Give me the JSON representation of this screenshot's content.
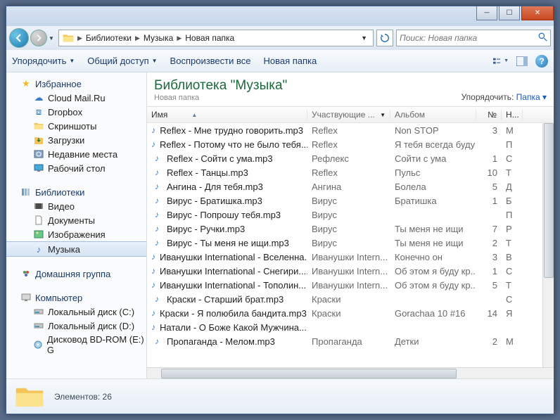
{
  "titlebar": {
    "min": "─",
    "max": "☐",
    "close": "✕"
  },
  "nav": {
    "crumbs": [
      "Библиотеки",
      "Музыка",
      "Новая папка"
    ],
    "search_placeholder": "Поиск: Новая папка"
  },
  "toolbar": {
    "organize": "Упорядочить",
    "share": "Общий доступ",
    "play_all": "Воспроизвести все",
    "new_folder": "Новая папка"
  },
  "sidebar": {
    "favorites": {
      "label": "Избранное",
      "items": [
        "Cloud Mail.Ru",
        "Dropbox",
        "Скриншоты",
        "Загрузки",
        "Недавние места",
        "Рабочий стол"
      ]
    },
    "libraries": {
      "label": "Библиотеки",
      "items": [
        "Видео",
        "Документы",
        "Изображения",
        "Музыка"
      ]
    },
    "homegroup": {
      "label": "Домашняя группа"
    },
    "computer": {
      "label": "Компьютер",
      "items": [
        "Локальный диск (C:)",
        "Локальный диск (D:)",
        "Дисковод BD-ROM (E:) G"
      ]
    }
  },
  "library": {
    "title": "Библиотека \"Музыка\"",
    "subtitle": "Новая папка",
    "arrange_label": "Упорядочить:",
    "arrange_value": "Папка"
  },
  "columns": {
    "name": "Имя",
    "artist": "Участвующие ...",
    "album": "Альбом",
    "num": "№",
    "h": "Н..."
  },
  "files": [
    {
      "name": "Reflex - Мне трудно говорить.mp3",
      "artist": "Reflex",
      "album": "Non STOP",
      "num": "3",
      "h": "М"
    },
    {
      "name": "Reflex - Потому что не было тебя....",
      "artist": "Reflex",
      "album": "Я тебя всегда буду ...",
      "num": "",
      "h": "П"
    },
    {
      "name": "Reflex - Сойти с ума.mp3",
      "artist": "Рефлекс",
      "album": "Сойти с ума",
      "num": "1",
      "h": "С"
    },
    {
      "name": "Reflex - Танцы.mp3",
      "artist": "Reflex",
      "album": "Пульс",
      "num": "10",
      "h": "Т"
    },
    {
      "name": "Ангина - Для тебя.mp3",
      "artist": "Ангина",
      "album": "Болела",
      "num": "5",
      "h": "Д"
    },
    {
      "name": "Вирус - Братишка.mp3",
      "artist": "Вирус",
      "album": "Братишка",
      "num": "1",
      "h": "Б"
    },
    {
      "name": "Вирус - Попрошу тебя.mp3",
      "artist": "Вирус",
      "album": "",
      "num": "",
      "h": "П"
    },
    {
      "name": "Вирус - Ручки.mp3",
      "artist": "Вирус",
      "album": "Ты меня не ищи",
      "num": "7",
      "h": "Р"
    },
    {
      "name": "Вирус - Ты меня не ищи.mp3",
      "artist": "Вирус",
      "album": "Ты меня не ищи",
      "num": "2",
      "h": "Т"
    },
    {
      "name": "Иванушки International - Вселенна...",
      "artist": "Иванушки Intern...",
      "album": "Конечно он",
      "num": "3",
      "h": "В"
    },
    {
      "name": "Иванушки International - Снегири....",
      "artist": "Иванушки Intern...",
      "album": "Об этом я буду кр...",
      "num": "1",
      "h": "С"
    },
    {
      "name": "Иванушки International - Тополин...",
      "artist": "Иванушки Intern...",
      "album": "Об этом я буду кр...",
      "num": "5",
      "h": "Т"
    },
    {
      "name": "Краски - Старший брат.mp3",
      "artist": "Краски",
      "album": "",
      "num": "",
      "h": "С"
    },
    {
      "name": "Краски - Я полюбила бандита.mp3",
      "artist": "Краски",
      "album": "Gorachaa 10 #16",
      "num": "14",
      "h": "Я"
    },
    {
      "name": "Натали - О Боже Какой Мужчина....",
      "artist": "",
      "album": "",
      "num": "",
      "h": ""
    },
    {
      "name": "Пропаганда - Мелом.mp3",
      "artist": "Пропаганда",
      "album": "Детки",
      "num": "2",
      "h": "М"
    }
  ],
  "status": {
    "count_label": "Элементов: 26"
  }
}
